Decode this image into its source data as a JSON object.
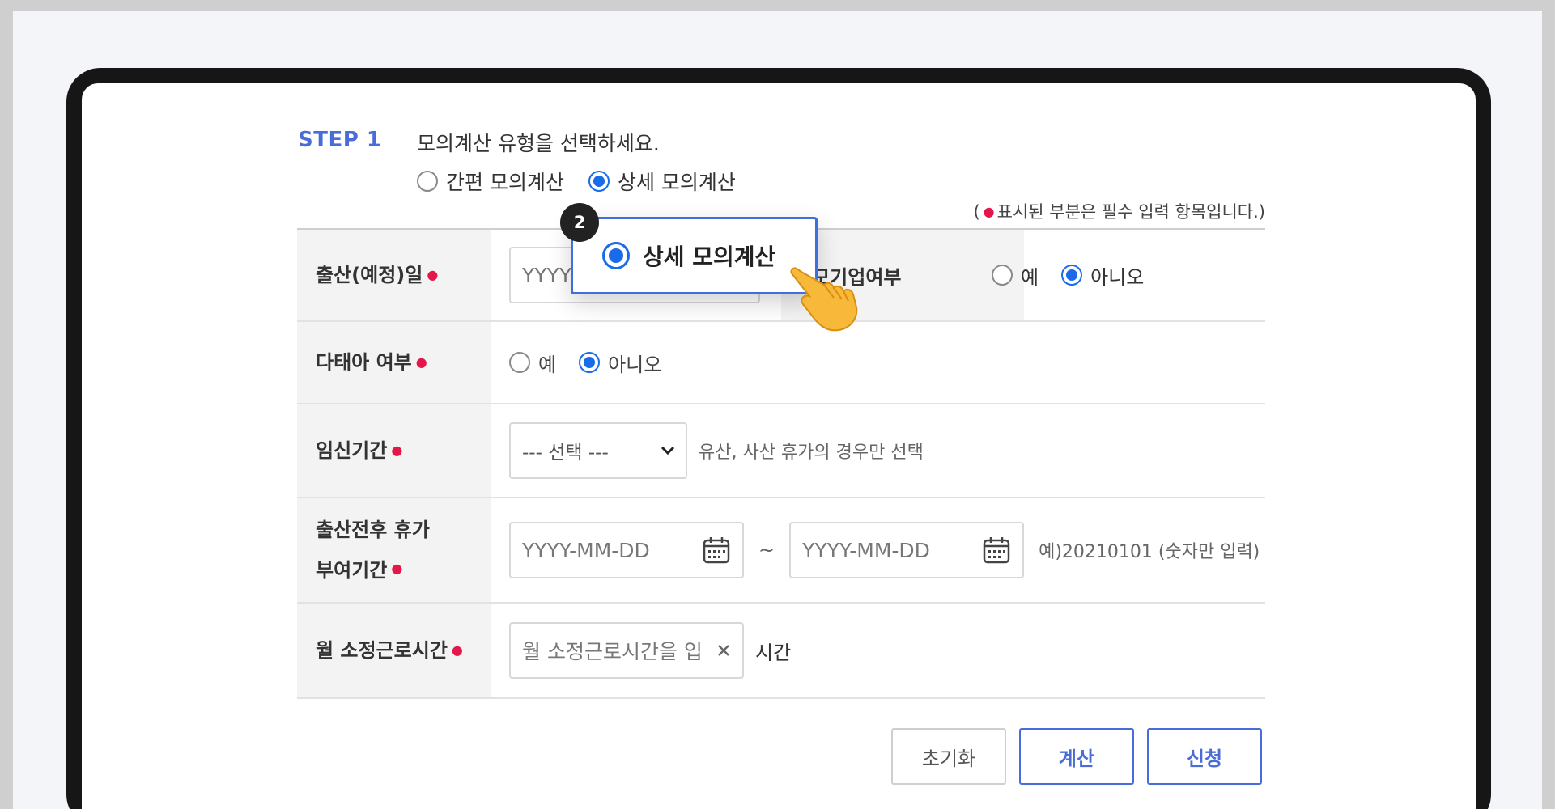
{
  "step": {
    "label": "STEP 1",
    "description": "모의계산 유형을 선택하세요.",
    "options": [
      {
        "label": "간편 모의계산",
        "selected": false
      },
      {
        "label": "상세 모의계산",
        "selected": true
      }
    ]
  },
  "required_note": {
    "prefix": "(",
    "text": "표시된 부분은 필수 입력 항목입니다.)"
  },
  "callout": {
    "badge": "2",
    "label": "상세 모의계산"
  },
  "form": {
    "birth_date": {
      "label": "출산(예정)일",
      "placeholder": "YYYY-MM-DD",
      "visible_value": "YYYY"
    },
    "company_size": {
      "label": "규모기업여부",
      "yes": "예",
      "no": "아니오",
      "selected": "아니오"
    },
    "multiple_birth": {
      "label": "다태아 여부",
      "yes": "예",
      "no": "아니오",
      "selected": "아니오"
    },
    "pregnancy_period": {
      "label": "임신기간",
      "select_value": "--- 선택 ---",
      "hint": "유산, 사산 휴가의 경우만 선택"
    },
    "leave_period": {
      "label_line1": "출산전후 휴가",
      "label_line2": "부여기간",
      "start_placeholder": "YYYY-MM-DD",
      "separator": "~",
      "end_placeholder": "YYYY-MM-DD",
      "hint": "예)20210101 (숫자만 입력)"
    },
    "monthly_hours": {
      "label": "월 소정근로시간",
      "placeholder": "월 소정근로시간을 입력",
      "unit": "시간"
    }
  },
  "buttons": {
    "reset": "초기화",
    "calculate": "계산",
    "apply": "신청"
  },
  "colors": {
    "accent": "#4a6cd8",
    "radio_selected": "#1a6bea",
    "required": "#e5164a",
    "callout_border": "#3e6fe0"
  }
}
